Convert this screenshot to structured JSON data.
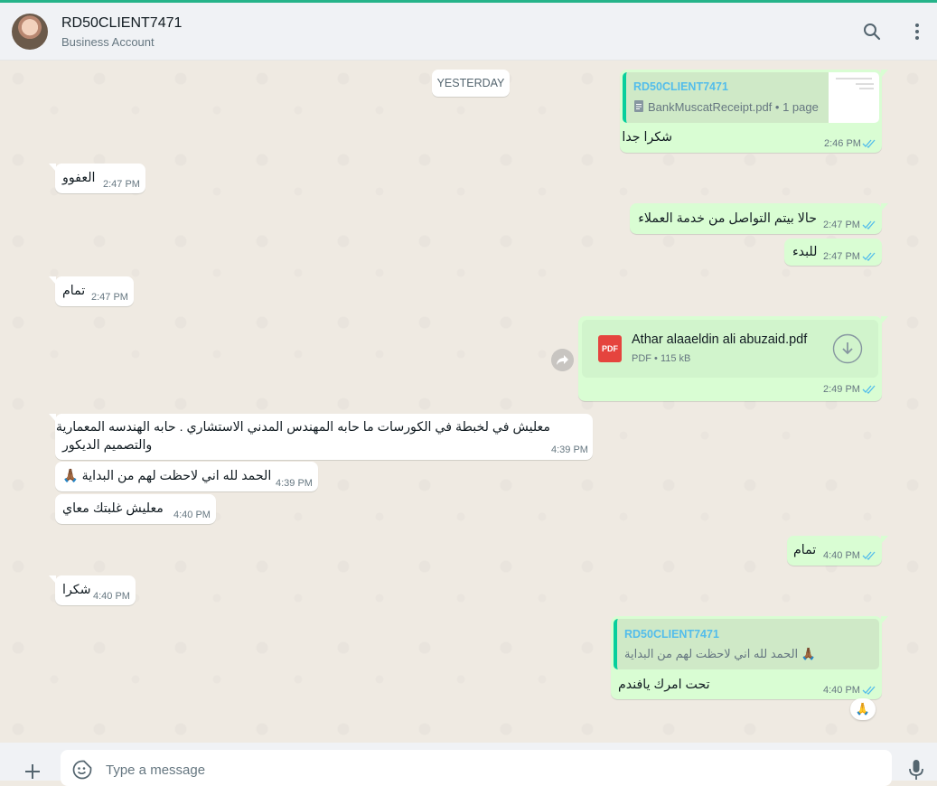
{
  "header": {
    "contact_name": "RD50CLIENT7471",
    "contact_subtitle": "Business Account",
    "search_icon": "search-icon",
    "menu_icon": "kebab-menu-icon"
  },
  "chat": {
    "date_separator": "YESTERDAY",
    "messages": [
      {
        "dir": "out",
        "quote_name": "RD50CLIENT7471",
        "quote_doc": "BankMuscatReceipt.pdf • 1 page",
        "text": "شكرا جدا",
        "time": "2:46 PM",
        "status": "read"
      },
      {
        "dir": "in",
        "text": "العفوو",
        "time": "2:47 PM"
      },
      {
        "dir": "out",
        "text": "حالا بيتم التواصل من خدمة العملاء",
        "time": "2:47 PM",
        "status": "read"
      },
      {
        "dir": "out",
        "text": "للبدء",
        "time": "2:47 PM",
        "status": "read"
      },
      {
        "dir": "in",
        "text": "تمام",
        "time": "2:47 PM"
      },
      {
        "dir": "out",
        "doc_name": "Athar alaaeldin ali abuzaid.pdf",
        "doc_meta": "PDF • 115 kB",
        "doc_badge": "PDF",
        "time": "2:49 PM",
        "status": "read"
      },
      {
        "dir": "in",
        "line1": "معليش في لخبطة في الكورسات ما حابه المهندس المدني الاستشاري . حابه الهندسه المعمارية",
        "line2": "والتصميم الديكور",
        "time": "4:39 PM"
      },
      {
        "dir": "in",
        "text": "الحمد لله اني لاحظت لهم من البداية 🙏🏾",
        "time": "4:39 PM"
      },
      {
        "dir": "in",
        "text": "معليش غلبتك معاي",
        "time": "4:40 PM"
      },
      {
        "dir": "out",
        "text": "تمام",
        "time": "4:40 PM",
        "status": "read"
      },
      {
        "dir": "in",
        "text": "شكرا",
        "time": "4:40 PM"
      },
      {
        "dir": "out",
        "quote_name": "RD50CLIENT7471",
        "quote_text": "الحمد لله اني لاحظت لهم من البداية 🙏🏾",
        "text": "تحت امرك يافندم",
        "time": "4:40 PM",
        "status": "read",
        "reaction": "🙏"
      }
    ]
  },
  "composer": {
    "placeholder": "Type a message",
    "attach_icon": "plus-icon",
    "sticker_icon": "sticker-icon",
    "mic_icon": "microphone-icon"
  },
  "colors": {
    "accent": "#25b389",
    "outgoing_bubble": "#d9fdd3",
    "incoming_bubble": "#ffffff",
    "read_ticks": "#53bdeb",
    "pdf_red": "#e5443e"
  }
}
